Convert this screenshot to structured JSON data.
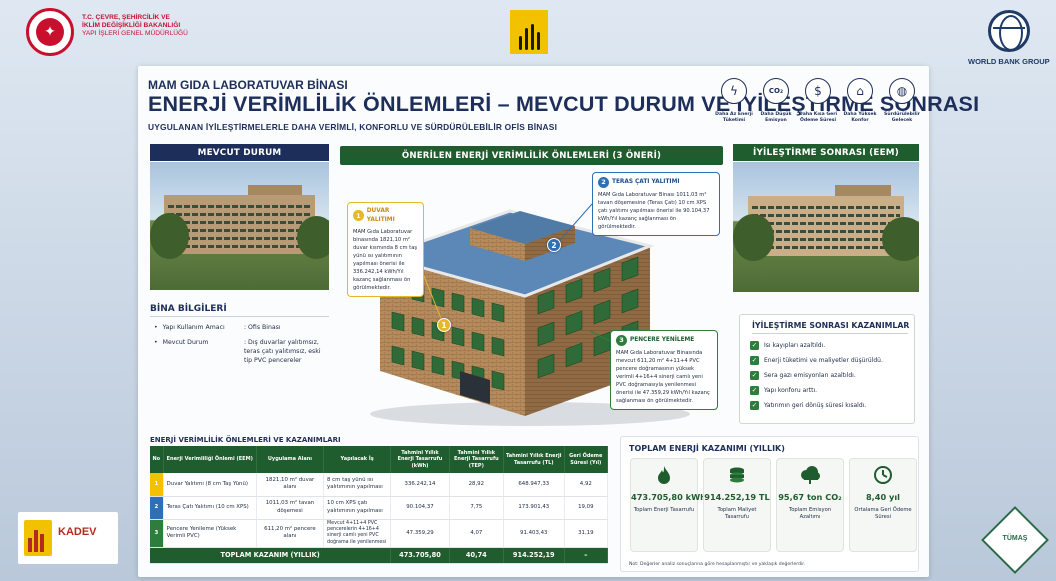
{
  "header": {
    "ministry_line1": "T.C. ÇEVRE, ŞEHİRCİLİK VE",
    "ministry_line2": "İKLİM DEĞİŞİKLİĞİ BAKANLIĞI",
    "ministry_line3": "YAPI İŞLERİ GENEL MÜDÜRLÜĞÜ",
    "worldbank": "WORLD BANK GROUP"
  },
  "title": {
    "small": "MAM GIDA LABORATUVAR BİNASI",
    "main": "ENERJİ VERİMLİLİK ÖNLEMLERİ – MEVCUT DURUM VE İYİLEŞTİRME SONRASI",
    "sub": "UYGULANAN İYİLEŞTİRMELERLE DAHA VERİMLİ, KONFORLU VE SÜRDÜRÜLEBİLİR OFİS BİNASI"
  },
  "benefits": [
    {
      "icon": "energy-icon",
      "glyph": "ϟ",
      "label": "Daha Az Enerji Tüketimi"
    },
    {
      "icon": "co2-icon",
      "glyph": "CO₂",
      "label": "Daha Düşük Emisyon"
    },
    {
      "icon": "money-icon",
      "glyph": "$",
      "label": "Daha Kısa Geri Ödeme Süresi"
    },
    {
      "icon": "home-icon",
      "glyph": "⌂",
      "label": "Daha Yüksek Konfor"
    },
    {
      "icon": "globe-icon",
      "glyph": "◍",
      "label": "Sürdürülebilir Gelecek"
    }
  ],
  "sections": {
    "mevcut": "MEVCUT DURUM",
    "onerilen": "ÖNERİLEN ENERJİ VERİMLİLİK ÖNLEMLERİ (3 ÖNERİ)",
    "eem": "İYİLEŞTİRME SONRASI (EEM)"
  },
  "bina": {
    "title": "BİNA BİLGİLERİ",
    "rows": [
      {
        "key": "Yapı Kullanım Amacı",
        "value": ": Ofis Binası"
      },
      {
        "key": "Mevcut Durum",
        "value": ": Dış duvarlar yalıtımsız, teras çatı yalıtımsız, eski tip PVC pencereler"
      }
    ]
  },
  "callouts": [
    {
      "num": "1",
      "title": "DUVAR YALITIMI",
      "text": "MAM Gıda Laboratuvar binasında 1821,10 m² duvar kısmında 8 cm taş yünü ısı yalıtımının yapılması önerisi ile 336.242,14 kWh/Yıl kazanç sağlanması ön görülmektedir."
    },
    {
      "num": "2",
      "title": "TERAS ÇATI YALITIMI",
      "text": "MAM Gıda Laboratuvar Binası 1011,03 m² tavan döşemesine (Teras Çatı) 10 cm XPS çatı yalıtımı yapılması önerisi ile 90.104,37 kWh/Yıl kazanç sağlanması ön görülmektedir."
    },
    {
      "num": "3",
      "title": "PENCERE YENİLEME",
      "text": "MAM Gıda Laboratuvar Binasında mevcut 611,20 m² 4+11+4 PVC pencere doğramasının yüksek verimli 4+16+4 sinerji camlı yeni PVC doğramasıyla yenilenmesi önerisi ile 47.359,29 kWh/Yıl kazanç sağlanması ön görülmektedir."
    }
  ],
  "kazanimlar": {
    "title": "İYİLEŞTİRME SONRASI KAZANIMLAR",
    "items": [
      "Isı kayıpları azaltıldı.",
      "Enerji tüketimi ve maliyetler düşürüldü.",
      "Sera gazı emisyonları azaltıldı.",
      "Yapı konforu arttı.",
      "Yatırımın geri dönüş süresi kısaldı."
    ]
  },
  "table": {
    "title": "ENERJİ VERİMLİLİK ÖNLEMLERİ VE KAZANIMLARI",
    "headers": [
      "No",
      "Enerji Verimliliği Önlemi (EEM)",
      "Uygulama Alanı",
      "Yapılacak İş",
      "Tahmini Yıllık Enerji Tasarrufu (kWh)",
      "Tahmini Yıllık Enerji Tasarrufu (TEP)",
      "Tahmini Yıllık Enerji Tasarrufu (TL)",
      "Geri Ödeme Süresi (Yıl)"
    ],
    "rows": [
      {
        "no": "1",
        "eem": "Duvar Yalıtımı (8 cm Taş Yünü)",
        "alan": "1821,10 m² duvar alanı",
        "is": "8 cm taş yünü ısı yalıtımının yapılması",
        "kwh": "336.242,14",
        "tep": "28,92",
        "tl": "648.947,33",
        "yil": "4,92"
      },
      {
        "no": "2",
        "eem": "Teras Çatı Yalıtımı (10 cm XPS)",
        "alan": "1011,03 m² tavan döşemesi",
        "is": "10 cm XPS çatı yalıtımının yapılması",
        "kwh": "90.104,37",
        "tep": "7,75",
        "tl": "173.901,43",
        "yil": "19,09"
      },
      {
        "no": "3",
        "eem": "Pencere Yenileme (Yüksek Verimli PVC)",
        "alan": "611,20 m² pencere alanı",
        "is": "Mevcut 4+11+4 PVC pencerelerin 4+16+4 sinerji camlı yeni PVC doğrama ile yenilenmesi",
        "kwh": "47.359,29",
        "tep": "4,07",
        "tl": "91.403,43",
        "yil": "31,19"
      }
    ],
    "total": {
      "label": "TOPLAM KAZANIM (YILLIK)",
      "kwh": "473.705,80",
      "tep": "40,74",
      "tl": "914.252,19",
      "yil": "–"
    }
  },
  "toplam": {
    "title": "TOPLAM ENERJİ KAZANIMI (YILLIK)",
    "kpis": [
      {
        "icon": "flame-icon",
        "glyph": "🔥",
        "value": "473.705,80 kWh",
        "caption": "Toplam Enerji Tasarrufu"
      },
      {
        "icon": "coins-icon",
        "glyph": "▤",
        "value": "914.252,19 TL",
        "caption": "Toplam Maliyet Tasarrufu"
      },
      {
        "icon": "cloud-icon",
        "glyph": "☁",
        "value": "95,67 ton CO₂",
        "caption": "Toplam Emisyon Azaltımı"
      },
      {
        "icon": "clock-icon",
        "glyph": "◷",
        "value": "8,40 yıl",
        "caption": "Ortalama Geri Ödeme Süresi"
      }
    ],
    "note": "Not: Değerler analiz sonuçlarına göre hesaplanmıştır ve yaklaşık değerlerdir."
  },
  "logos": {
    "kadev": "KADEV",
    "tumas": "TÜMAŞ"
  }
}
